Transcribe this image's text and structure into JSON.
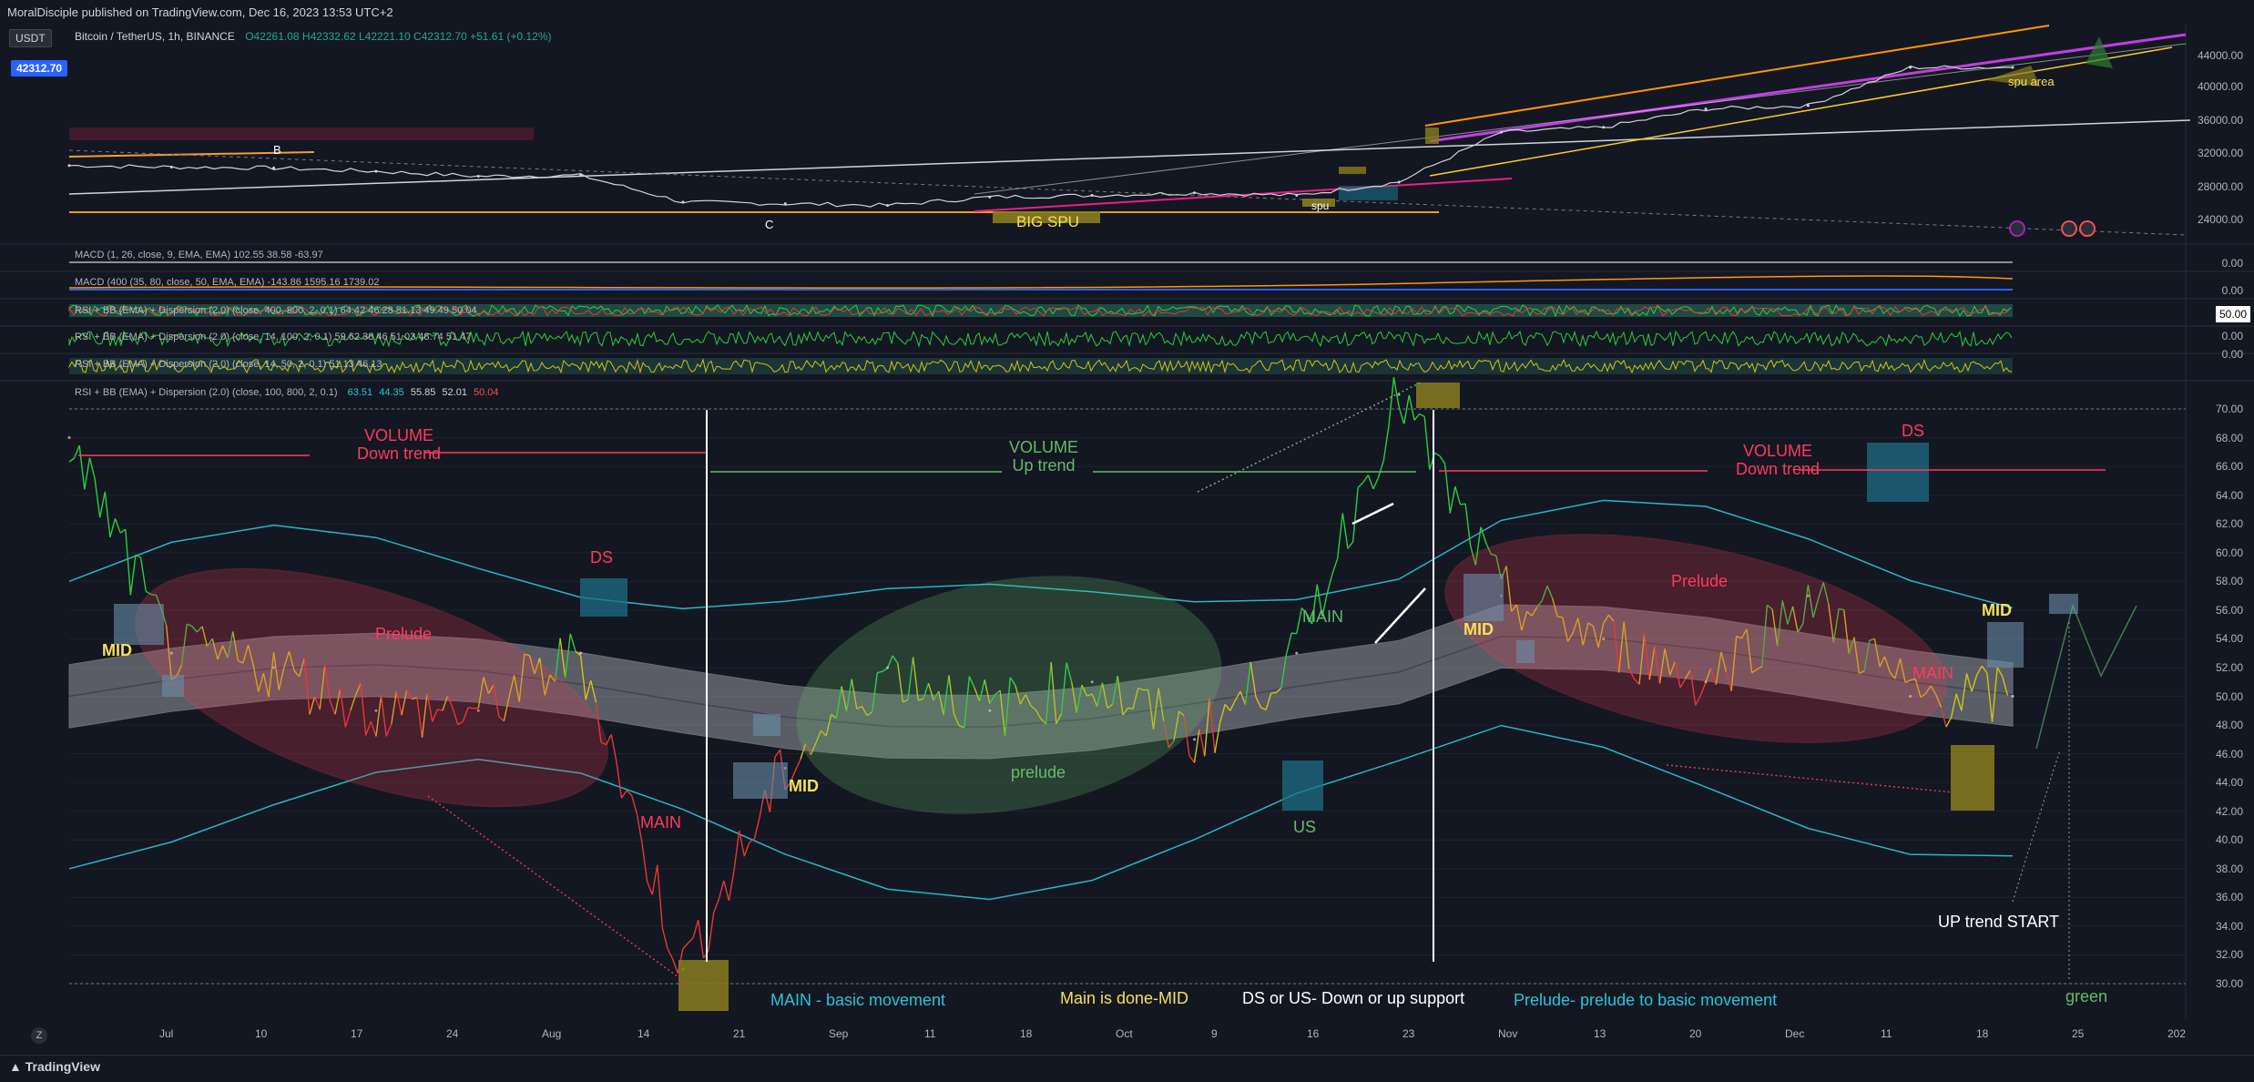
{
  "publisher_line": "MoralDisciple published on TradingView.com, Dec 16, 2023 13:53 UTC+2",
  "symbol_chip": "USDT",
  "price_chip": "42312.70",
  "header": {
    "title": "Bitcoin / TetherUS, 1h, BINANCE",
    "ohlc": "O42261.08 H42332.62 L42221.10 C42312.70 +51.61 (+0.12%)"
  },
  "indicators": {
    "macd1": "MACD (1, 26, close, 9, EMA, EMA)  102.55  38.58  -63.97",
    "macd2": "MACD (400 (35, 80, close, 50, EMA, EMA)  -143.86  1595.16  1739.02",
    "rsi1": "RSI + BB (EMA) + Dispersion (2.0) (close, 400, 800, 2, 0.1)  64.42  46.28  51.13  49.49  50.04",
    "rsi2": "RSI + BB (EMA) + Dispersion (2.0) (close, 14, 100, 2, 0.1)  59.62  38.46  51.03  48.74  51.47",
    "rsi3": "RSI + BB (EMA) + Dispersion (2.0) (close, 14, 50, 2, 0.1)  51.13  46.13",
    "rsi_main": "RSI + BB (EMA) + Dispersion (2.0) (close, 100, 800, 2, 0.1)",
    "rsi_main_vals": [
      "63.51",
      "44.35",
      "55.85",
      "52.01",
      "50.04"
    ]
  },
  "price_axis": [
    "40000.00",
    "36000.00",
    "32000.00",
    "28000.00",
    "24000.00"
  ],
  "price_axis_top": "44000.00",
  "osc_axis": [
    "0.00",
    "0.00",
    "50.00",
    "0.00",
    "0.00"
  ],
  "rsi_axis": [
    "70.00",
    "68.00",
    "66.00",
    "64.00",
    "62.00",
    "60.00",
    "58.00",
    "56.00",
    "54.00",
    "52.00",
    "50.00",
    "48.00",
    "46.00",
    "44.00",
    "42.00",
    "40.00",
    "38.00",
    "36.00",
    "34.00",
    "32.00",
    "30.00"
  ],
  "x_axis": [
    "Jul",
    "10",
    "17",
    "24",
    "Aug",
    "14",
    "21",
    "Sep",
    "11",
    "18",
    "Oct",
    "9",
    "16",
    "23",
    "Nov",
    "13",
    "20",
    "Dec",
    "11",
    "18",
    "25",
    "202"
  ],
  "price_annotations": {
    "b": "B",
    "c": "C",
    "big_spu": "BIG SPU",
    "spu": "spu",
    "spu_area": "spu area"
  },
  "annotations": {
    "volume_down_1": "VOLUME\nDown trend",
    "volume_up": "VOLUME\nUp trend",
    "volume_down_2": "VOLUME\nDown trend",
    "prelude_1": "Prelude",
    "prelude_2": "prelude",
    "prelude_3": "Prelude",
    "mid_1": "MID",
    "mid_2": "MID",
    "mid_3": "MID",
    "mid_4": "MID",
    "main_1": "MAIN",
    "main_2": "MAIN",
    "main_3": "MAIN",
    "ds_1": "DS",
    "ds_2": "DS",
    "us": "US",
    "up_trend_start": "UP trend START",
    "green": "green"
  },
  "legend": {
    "main": "MAIN - basic movement",
    "mid": "Main is done-MID",
    "ds_us": "DS or US- Down or up support",
    "prelude": "Prelude- prelude to basic movement"
  },
  "footer": "TradingView",
  "colors": {
    "background": "#131722",
    "bull": "#26a69a",
    "bear": "#ef5350",
    "rsi_green": "#2ecc40",
    "rsi_red": "#e53935",
    "rsi_yellow": "#d4c11a",
    "band_line": "#29b6c6",
    "prelude_red": "#e53950",
    "prelude_green": "#66bb6a",
    "box_teal": "#1f6e86",
    "box_olive": "#8a7d1e"
  },
  "chart_data": [
    {
      "type": "line",
      "title": "Bitcoin / TetherUS, 1h, BINANCE",
      "x": [
        "Jul",
        "10",
        "17",
        "24",
        "Aug",
        "14",
        "21",
        "Sep",
        "11",
        "18",
        "Oct",
        "9",
        "16",
        "23",
        "Nov",
        "13",
        "20",
        "Dec",
        "11",
        "18"
      ],
      "series": [
        {
          "values": [
            30500,
            30300,
            30200,
            29800,
            29200,
            29300,
            26100,
            25900,
            25700,
            26700,
            26900,
            27200,
            26900,
            28500,
            34500,
            35100,
            37300,
            37700,
            42300,
            42300
          ]
        }
      ],
      "ylim": [
        22000,
        44000
      ]
    },
    {
      "type": "line",
      "title": "RSI + BB (EMA) + Dispersion (2.0) (close, 100, 800, 2, 0.1)",
      "x": [
        "Jul",
        "10",
        "17",
        "24",
        "Aug",
        "14",
        "21",
        "Sep",
        "11",
        "18",
        "Oct",
        "9",
        "16",
        "23",
        "Nov",
        "13",
        "20",
        "Dec",
        "11",
        "18"
      ],
      "series": [
        {
          "values": [
            68,
            53,
            52,
            49,
            49,
            53,
            31,
            45,
            52,
            49,
            51,
            47,
            53,
            71,
            57,
            54,
            51,
            57,
            50,
            50
          ]
        }
      ],
      "ylim": [
        29,
        71
      ]
    }
  ]
}
